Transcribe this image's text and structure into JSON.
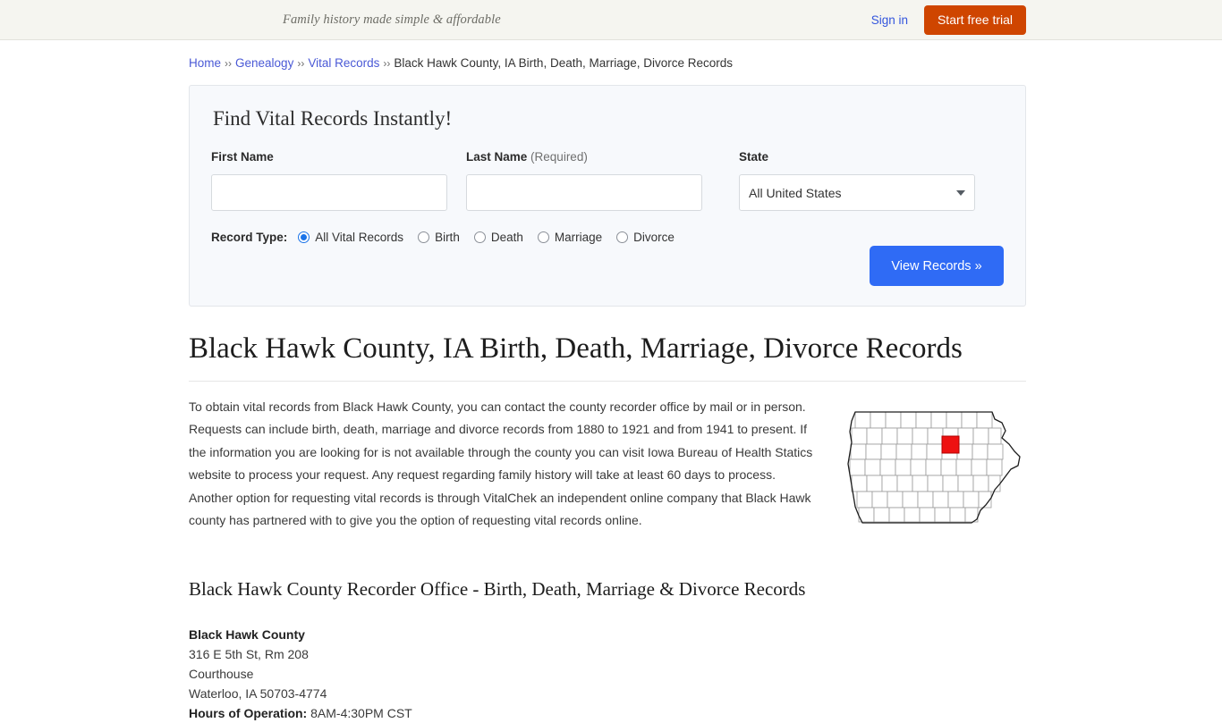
{
  "topbar": {
    "tagline": "Family history made simple & affordable",
    "signin_label": "Sign in",
    "trial_label": "Start free trial"
  },
  "breadcrumb": {
    "separator": "››",
    "items": [
      {
        "label": "Home",
        "link": true
      },
      {
        "label": "Genealogy",
        "link": true
      },
      {
        "label": "Vital Records",
        "link": true
      },
      {
        "label": "Black Hawk County, IA Birth, Death, Marriage, Divorce Records",
        "link": false
      }
    ]
  },
  "search_panel": {
    "title": "Find Vital Records Instantly!",
    "first_name": {
      "label": "First Name",
      "value": "",
      "placeholder": ""
    },
    "last_name": {
      "label": "Last Name",
      "required_note": "(Required)",
      "value": "",
      "placeholder": ""
    },
    "state": {
      "label": "State",
      "selected": "All United States"
    },
    "record_type": {
      "label": "Record Type:",
      "options": [
        {
          "label": "All Vital Records",
          "selected": true
        },
        {
          "label": "Birth",
          "selected": false
        },
        {
          "label": "Death",
          "selected": false
        },
        {
          "label": "Marriage",
          "selected": false
        },
        {
          "label": "Divorce",
          "selected": false
        }
      ]
    },
    "submit_label": "View Records »"
  },
  "main": {
    "heading": "Black Hawk County, IA Birth, Death, Marriage, Divorce Records",
    "intro": "To obtain vital records from Black Hawk County, you can contact the county recorder office by mail or in person. Requests can include birth, death, marriage and divorce records from 1880 to 1921 and from 1941 to present. If the information you are looking for is not available through the county you can visit Iowa Bureau of Health Statics website to process your request. Any request regarding family history will take at least 60 days to process. Another option for requesting vital records is through VitalChek an independent online company that Black Hawk county has partnered with to give you the option of requesting vital records online.",
    "map": {
      "alt": "Map of Iowa counties with Black Hawk County highlighted",
      "highlight_color": "#ee1111"
    },
    "subheading": "Black Hawk County Recorder Office - Birth, Death, Marriage & Divorce Records",
    "address": {
      "name": "Black Hawk County",
      "street": "316 E 5th St, Rm 208",
      "building": "Courthouse",
      "city_state_zip": "Waterloo, IA 50703-4774",
      "hours_label": "Hours of Operation:",
      "hours_value": "8AM-4:30PM CST"
    }
  }
}
